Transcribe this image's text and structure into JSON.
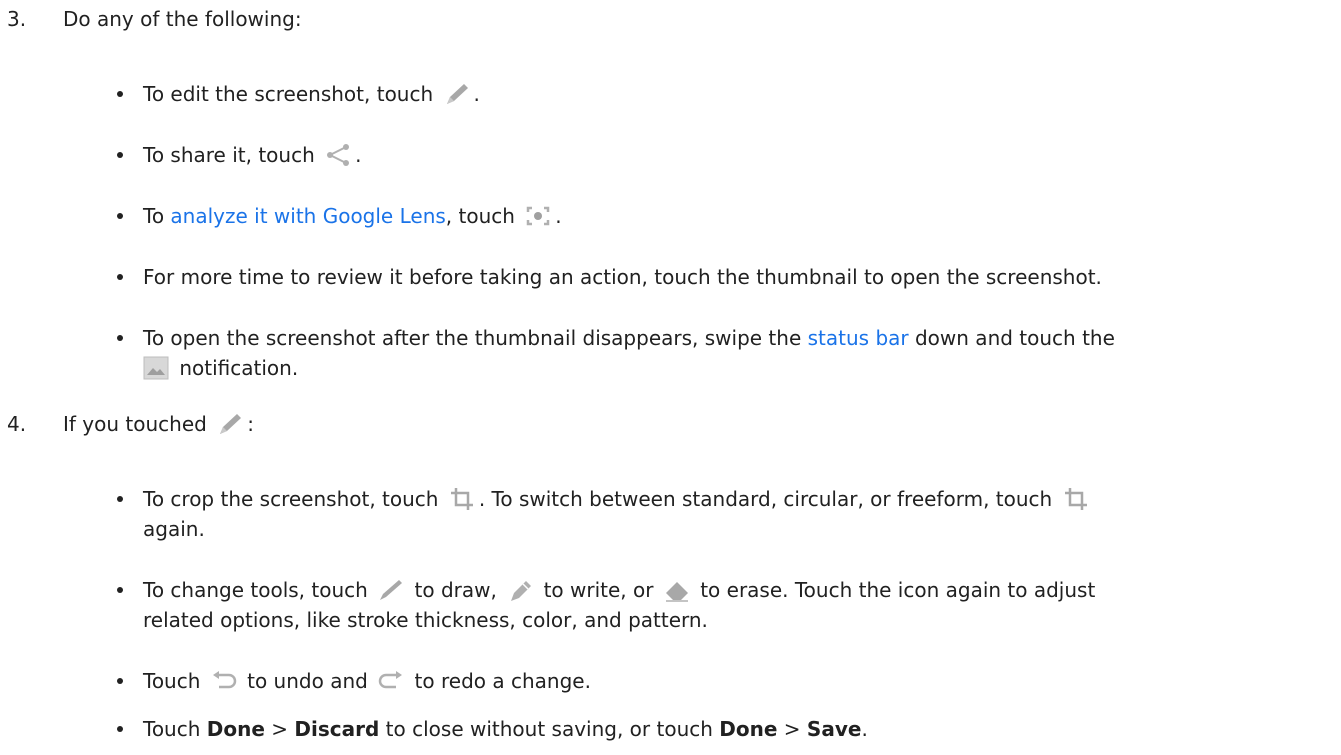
{
  "steps": [
    {
      "number": "3.",
      "text": "Do any of the following:"
    },
    {
      "number": "4.",
      "text_before": "If you touched",
      "text_after": ":",
      "icon": "pencil-icon"
    }
  ],
  "step3_bullets": {
    "edit": {
      "before": "To edit the screenshot, touch",
      "after": ".",
      "icon": "pencil-icon"
    },
    "share": {
      "before": "To share it, touch",
      "after": ".",
      "icon": "share-icon"
    },
    "lens": {
      "before": "To",
      "link": "analyze it with Google Lens",
      "middle": ", touch",
      "after": ".",
      "icon": "lens-icon"
    },
    "review": {
      "text": "For more time to review it before taking an action, touch the thumbnail to open the screenshot."
    },
    "open": {
      "before": "To open the screenshot after the thumbnail disappears, swipe the",
      "link": "status bar",
      "after": "down and touch the",
      "icon": "image-icon",
      "line2": "notification."
    }
  },
  "step4_bullets": {
    "crop": {
      "before": "To crop the screenshot, touch",
      "middle": ". To switch between standard, circular, or freeform, touch",
      "line2": "again.",
      "icon": "crop-icon"
    },
    "tools": {
      "before": "To change tools, touch",
      "draw": "to draw,",
      "write": "to write, or",
      "erase": "to erase. Touch the icon again to adjust",
      "line2": "related options, like stroke thickness, color, and pattern.",
      "icons": [
        "pen-icon",
        "highlighter-icon",
        "eraser-icon"
      ]
    },
    "undo": {
      "before": "Touch",
      "middle": "to undo and",
      "after": "to redo a change.",
      "icons": [
        "undo-icon",
        "redo-icon"
      ]
    },
    "done": {
      "before": "Touch",
      "done1": "Done",
      "sep1": ">",
      "discard": "Discard",
      "middle": "to close without saving, or touch",
      "done2": "Done",
      "sep2": ">",
      "save": "Save",
      "after": "."
    }
  },
  "colors": {
    "text": "#212121",
    "link": "#1a73e8",
    "icon": "#9e9e9e"
  }
}
